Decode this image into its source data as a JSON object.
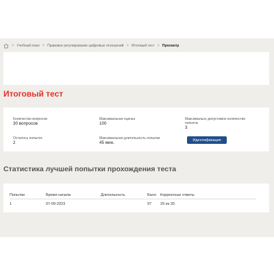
{
  "breadcrumb": {
    "items": [
      "Учебный план",
      "Правовое регулирование цифровых отношений",
      "Итоговый тест"
    ],
    "current": "Просмотр",
    "separator": ">"
  },
  "page": {
    "title": "Итоговый тест"
  },
  "info": {
    "questions_label": "Количество вопросов",
    "questions_value": "30 вопросов",
    "max_score_label": "Максимальная оценка",
    "max_score_value": "100",
    "max_attempts_label": "Максимально допустимое количество попыток",
    "max_attempts_value": "3",
    "attempts_left_label": "Осталось попыток",
    "attempts_left_value": "2",
    "max_duration_label": "Максимальная длительность попытки",
    "max_duration_value": "45 мин.",
    "identify_button": "Идентификация"
  },
  "stats": {
    "title": "Статистика лучшей попытки прохождения теста",
    "columns": [
      "Попытки",
      "Время начала",
      "Длительность",
      "Балл",
      "Корректные ответы"
    ],
    "rows": [
      [
        "1",
        "07-09-2023",
        "",
        "97",
        "29 из 30"
      ]
    ]
  },
  "colors": {
    "accent": "#e4312b",
    "button": "#1f4e8c",
    "frame_bg": "#efeeea"
  }
}
